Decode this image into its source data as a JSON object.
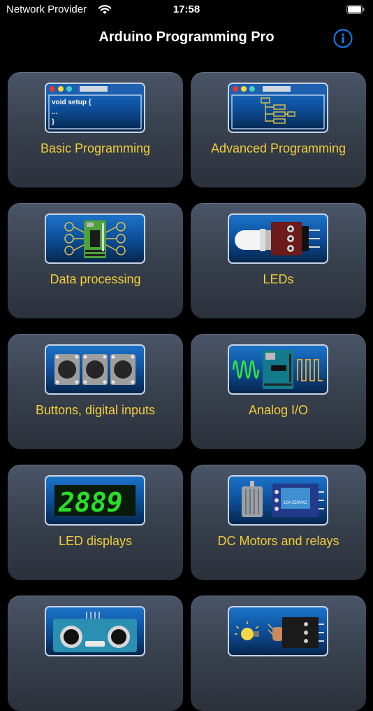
{
  "status_bar": {
    "carrier": "Network Provider",
    "time": "17:58"
  },
  "header": {
    "title": "Arduino Programming Pro",
    "info_icon": "info-circle-icon"
  },
  "code_snippet": {
    "line1": "void setup {",
    "line2": "...",
    "line3": "}"
  },
  "relay_text": "10A 250VAC",
  "tiles": [
    {
      "label": "Basic Programming",
      "icon": "code-window-icon"
    },
    {
      "label": "Advanced Programming",
      "icon": "flowchart-window-icon"
    },
    {
      "label": "Data processing",
      "icon": "data-processing-icon"
    },
    {
      "label": "LEDs",
      "icon": "led-module-icon"
    },
    {
      "label": "Buttons, digital inputs",
      "icon": "push-buttons-icon"
    },
    {
      "label": "Analog I/O",
      "icon": "analog-signal-icon"
    },
    {
      "label": "LED displays",
      "icon": "seven-segment-display-icon"
    },
    {
      "label": "DC Motors and relays",
      "icon": "motor-relay-icon"
    },
    {
      "label": "",
      "icon": "ultrasonic-sensor-icon"
    },
    {
      "label": "",
      "icon": "light-sensor-icon"
    }
  ],
  "colors": {
    "label": "#f2cd3a",
    "accent": "#0a84ff",
    "icon_bg": "#0d4f9a"
  }
}
